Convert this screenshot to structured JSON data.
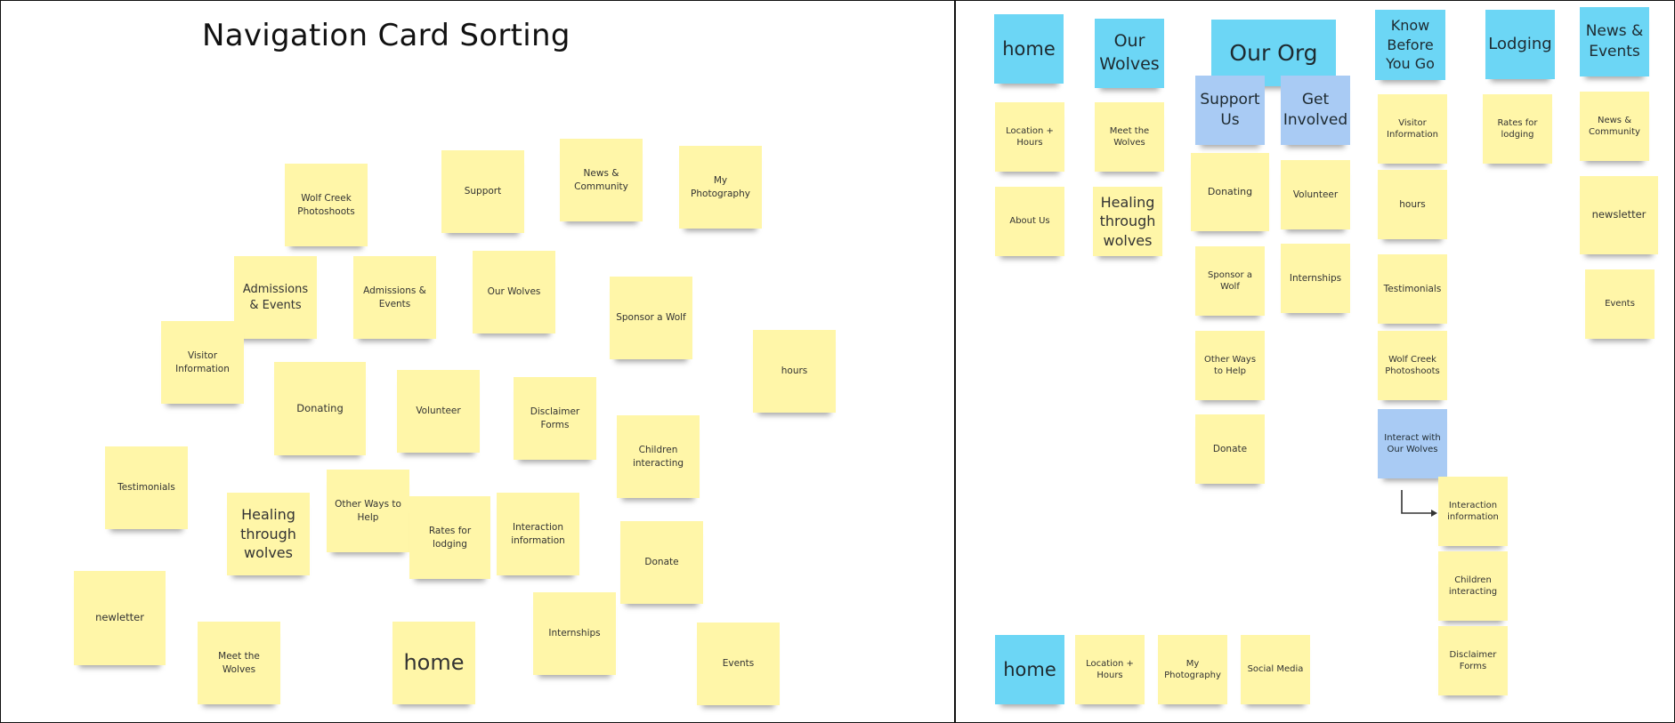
{
  "title": "Navigation Card Sorting",
  "colors": {
    "sticky_yellow": "#fff6a8",
    "category_cyan": "#6cd6f5",
    "subcategory_blue": "#a9cbf4"
  },
  "unsorted_cards": [
    "Wolf Creek Photoshoots",
    "Support",
    "News & Community",
    "My Photography",
    "Admissions & Events",
    "Admissions & Events",
    "Our Wolves",
    "Sponsor a Wolf",
    "hours",
    "Visitor Information",
    "Donating",
    "Volunteer",
    "Disclaimer Forms",
    "Children interacting",
    "Testimonials",
    "Healing through wolves",
    "Other Ways to Help",
    "Rates for lodging",
    "Interaction information",
    "Donate",
    "newletter",
    "Meet the Wolves",
    "home",
    "Internships",
    "Events"
  ],
  "sorted_cards": [
    "home",
    "Our Wolves",
    "Our Org",
    "Support Us",
    "Get Involved",
    "Know Before You Go",
    "Lodging",
    "News & Events",
    "Location + Hours",
    "Meet the Wolves",
    "About Us",
    "Healing through wolves",
    "Donating",
    "Volunteer",
    "Sponsor a Wolf",
    "Internships",
    "Other Ways to Help",
    "Donate",
    "Visitor Information",
    "hours",
    "Testimonials",
    "Wolf Creek Photoshoots",
    "Interact with Our Wolves",
    "Interaction information",
    "Children interacting",
    "Disclaimer Forms",
    "Rates for lodging",
    "News & Community",
    "newsletter",
    "Events",
    "home",
    "Location + Hours",
    "My Photography",
    "Social Media"
  ]
}
